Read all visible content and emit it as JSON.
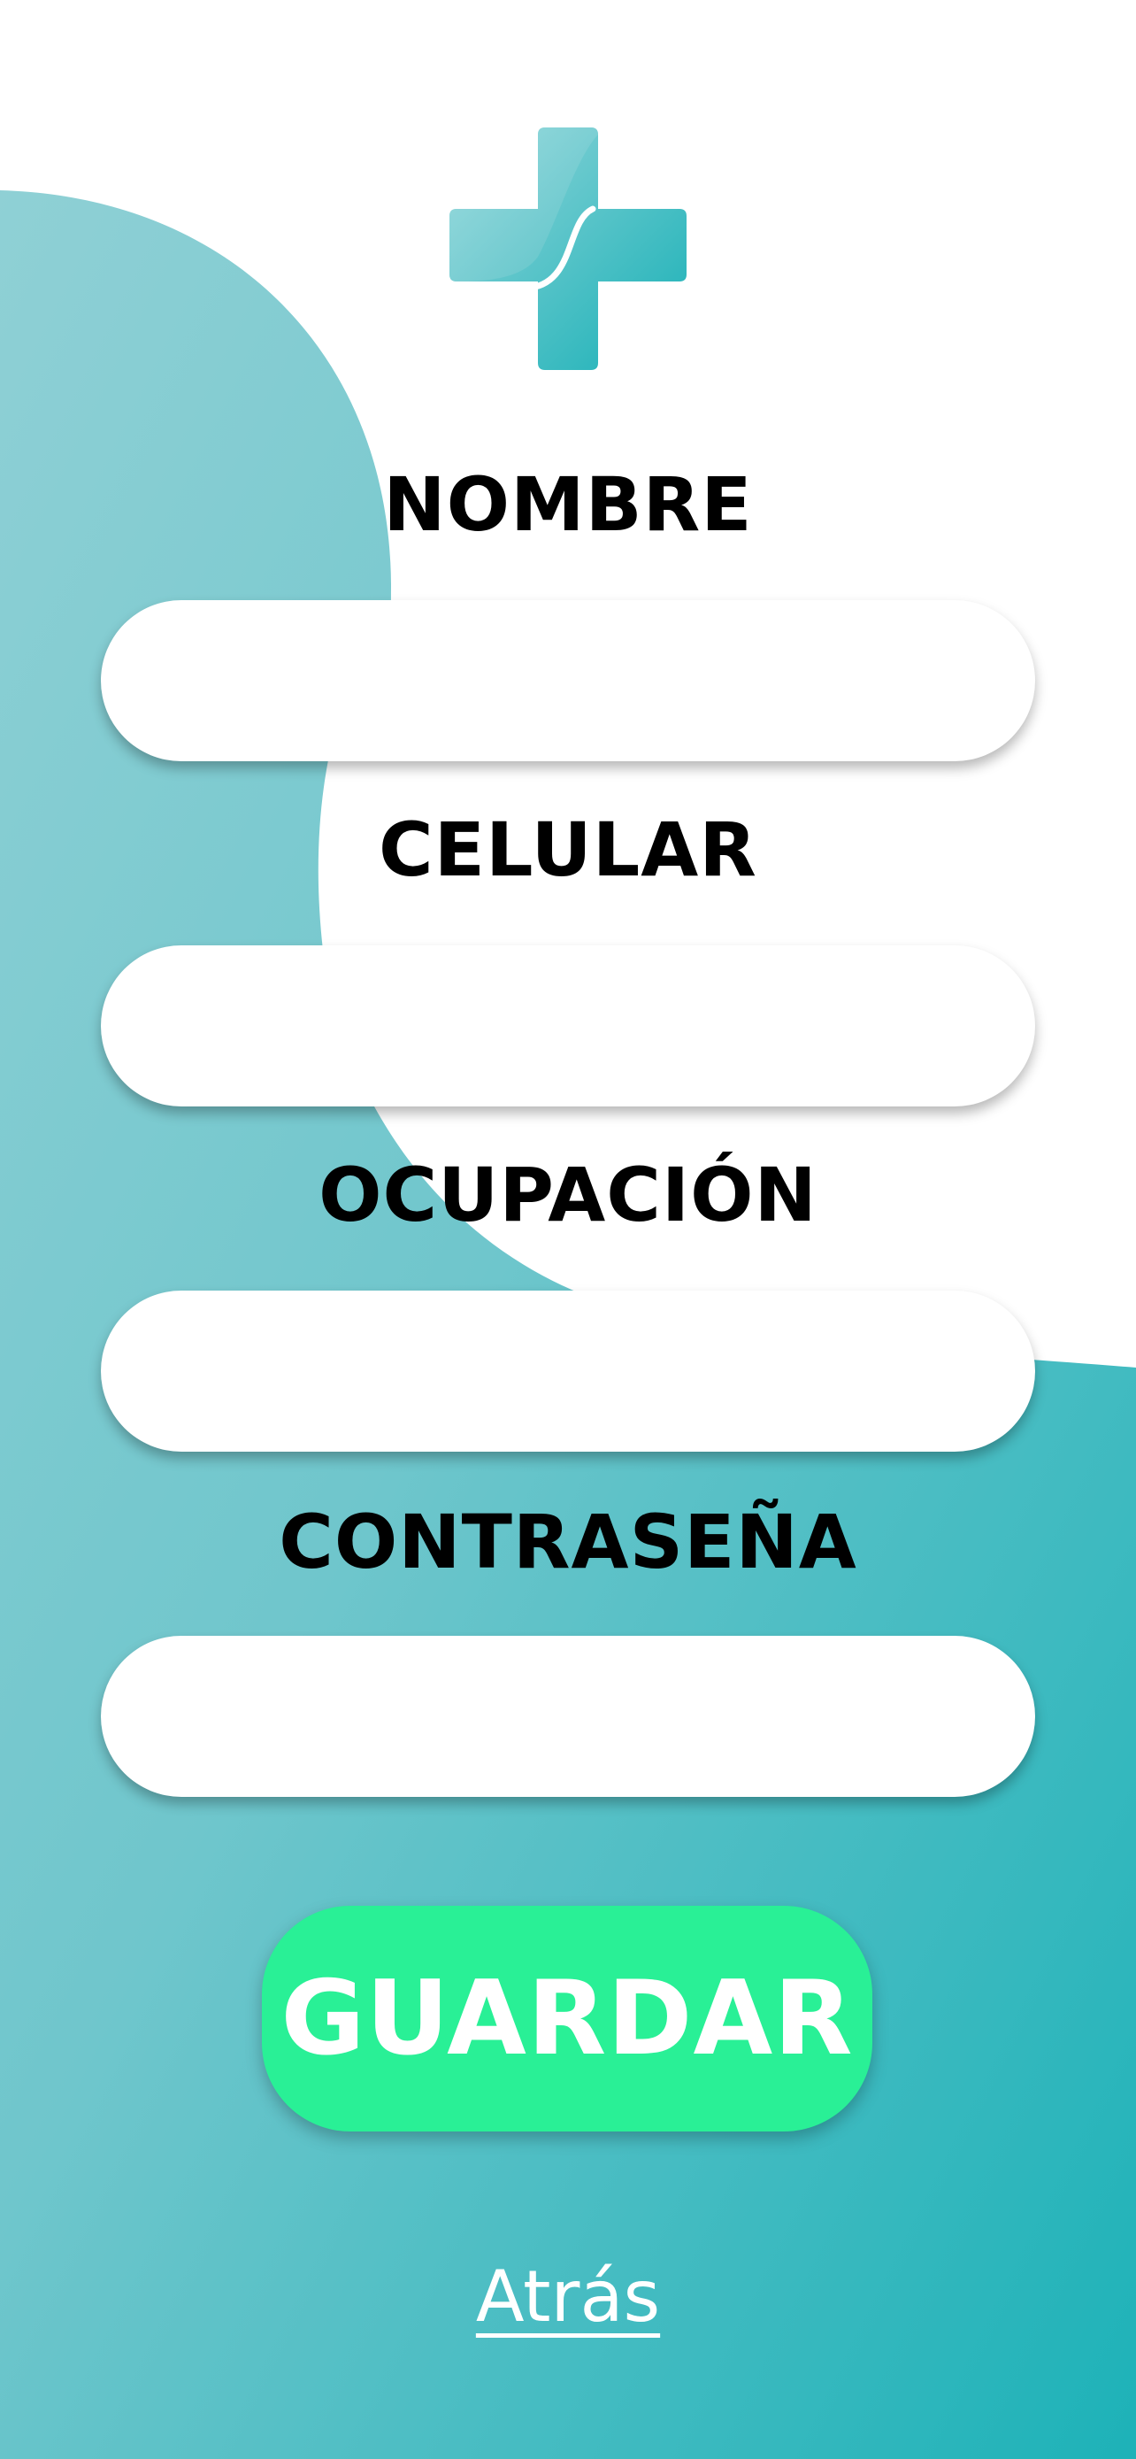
{
  "colors": {
    "teal_light": "#8fd0d5",
    "teal_dark": "#1db2b8",
    "button_green": "#29f096",
    "label_text": "#000000",
    "button_text": "#ffffff"
  },
  "logo": {
    "icon": "medical-cross-icon"
  },
  "form": {
    "fields": [
      {
        "label": "NOMBRE",
        "value": "",
        "placeholder": ""
      },
      {
        "label": "CELULAR",
        "value": "",
        "placeholder": ""
      },
      {
        "label": "OCUPACIÓN",
        "value": "",
        "placeholder": ""
      },
      {
        "label": "CONTRASEÑA",
        "value": "",
        "placeholder": ""
      }
    ],
    "save_label": "GUARDAR",
    "back_label": "Atrás"
  }
}
